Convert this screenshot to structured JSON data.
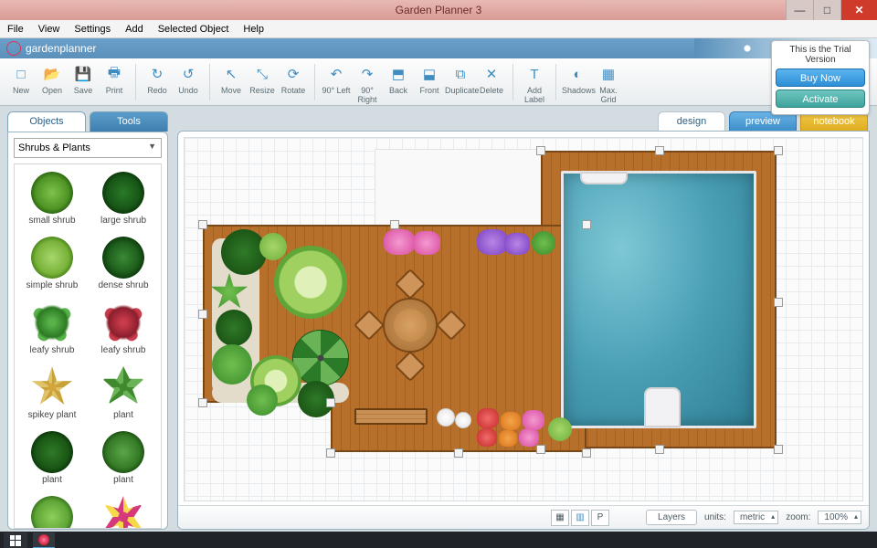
{
  "title": "Garden Planner 3",
  "window": {
    "minimize": "—",
    "maximize": "□",
    "close": "✕"
  },
  "menu": [
    "File",
    "View",
    "Settings",
    "Add",
    "Selected Object",
    "Help"
  ],
  "brand": "gardenplanner",
  "toolbar": [
    {
      "name": "new",
      "label": "New",
      "icon": "□",
      "sep": false
    },
    {
      "name": "open",
      "label": "Open",
      "icon": "📂",
      "sep": false
    },
    {
      "name": "save",
      "label": "Save",
      "icon": "💾",
      "sep": false
    },
    {
      "name": "print",
      "label": "Print",
      "icon": "🖶",
      "sep": true
    },
    {
      "name": "redo",
      "label": "Redo",
      "icon": "↻",
      "sep": false
    },
    {
      "name": "undo",
      "label": "Undo",
      "icon": "↺",
      "sep": true
    },
    {
      "name": "move",
      "label": "Move",
      "icon": "↖",
      "sep": false
    },
    {
      "name": "resize",
      "label": "Resize",
      "icon": "⤡",
      "sep": false
    },
    {
      "name": "rotate",
      "label": "Rotate",
      "icon": "⟳",
      "sep": true
    },
    {
      "name": "rot-left",
      "label": "90° Left",
      "icon": "↶",
      "sep": false
    },
    {
      "name": "rot-right",
      "label": "90° Right",
      "icon": "↷",
      "sep": false
    },
    {
      "name": "back",
      "label": "Back",
      "icon": "⬒",
      "sep": false
    },
    {
      "name": "front",
      "label": "Front",
      "icon": "⬓",
      "sep": false
    },
    {
      "name": "duplicate",
      "label": "Duplicate",
      "icon": "⧉",
      "sep": false
    },
    {
      "name": "delete",
      "label": "Delete",
      "icon": "✕",
      "sep": true
    },
    {
      "name": "add-label",
      "label": "Add Label",
      "icon": "T",
      "sep": true
    },
    {
      "name": "shadows",
      "label": "Shadows",
      "icon": "◐",
      "sep": false
    },
    {
      "name": "max-grid",
      "label": "Max. Grid",
      "icon": "▦",
      "sep": false
    }
  ],
  "trial": {
    "title": "This is the Trial Version",
    "buy": "Buy Now",
    "activate": "Activate"
  },
  "leftTabs": {
    "objects": "Objects",
    "tools": "Tools"
  },
  "category": "Shrubs & Plants",
  "objects": [
    {
      "label": "small shrub",
      "cls": "shrub1"
    },
    {
      "label": "large shrub",
      "cls": "shrub2"
    },
    {
      "label": "simple shrub",
      "cls": "shrub3"
    },
    {
      "label": "dense shrub",
      "cls": "shrub4"
    },
    {
      "label": "leafy shrub",
      "cls": "shrub5"
    },
    {
      "label": "leafy shrub",
      "cls": "shrub6"
    },
    {
      "label": "spikey plant",
      "cls": "shrub7"
    },
    {
      "label": "plant",
      "cls": "shrub8"
    },
    {
      "label": "plant",
      "cls": "shrub9"
    },
    {
      "label": "plant",
      "cls": "shrub10"
    },
    {
      "label": "",
      "cls": "shrub12"
    },
    {
      "label": "",
      "cls": "shrub11"
    }
  ],
  "canvasTabs": {
    "design": "design",
    "preview": "preview",
    "notebook": "notebook"
  },
  "statusbar": {
    "layers": "Layers",
    "unitsLabel": "units:",
    "unitsValue": "metric",
    "zoomLabel": "zoom:",
    "zoomValue": "100%",
    "gridBtnP": "P"
  }
}
